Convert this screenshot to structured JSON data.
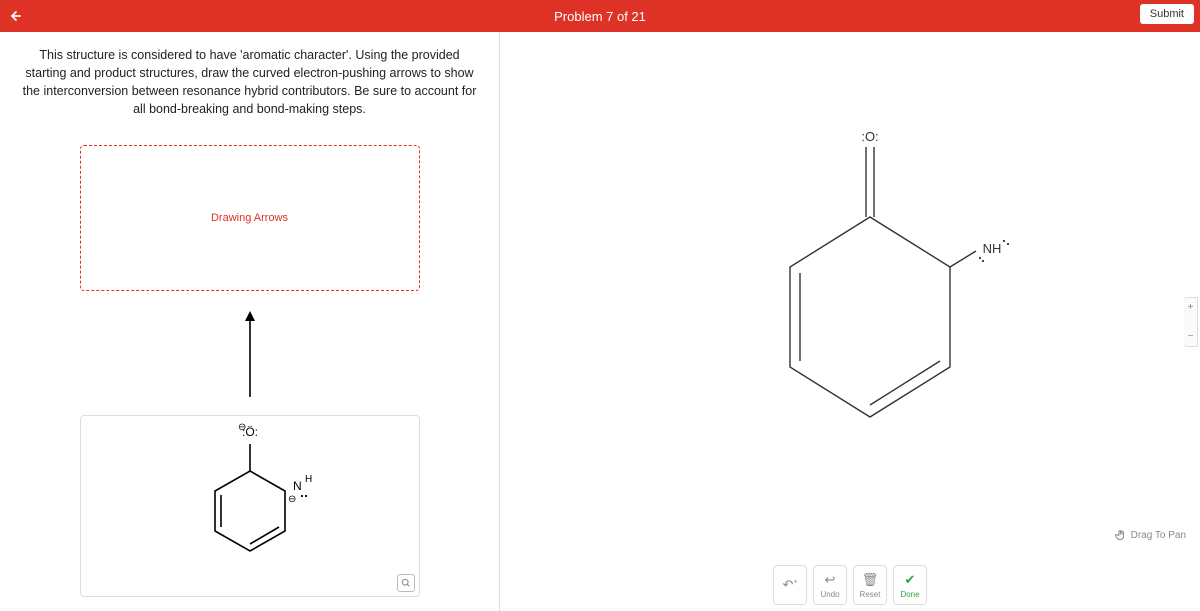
{
  "header": {
    "title": "Problem 7 of 21",
    "submit_label": "Submit"
  },
  "question": {
    "text": "This structure is considered to have 'aromatic character'. Using the provided starting and product structures, draw the curved electron-pushing arrows to show the interconversion between resonance hybrid contributors. Be sure to account for all bond-breaking and bond-making steps."
  },
  "drawing_box": {
    "label": "Drawing Arrows"
  },
  "toolbar": {
    "undo": "Undo",
    "reset": "Reset",
    "done": "Done"
  },
  "hints": {
    "drag_pan": "Drag To Pan"
  },
  "molecule_left": {
    "oxygen_label": ":Ö:",
    "nh_label_n": "N",
    "nh_label_h": "H",
    "charge": "⊖"
  },
  "molecule_right": {
    "oxygen_label": ":O:",
    "nh_label": "NH"
  },
  "zoom": {
    "plus": "+",
    "minus": "−"
  }
}
